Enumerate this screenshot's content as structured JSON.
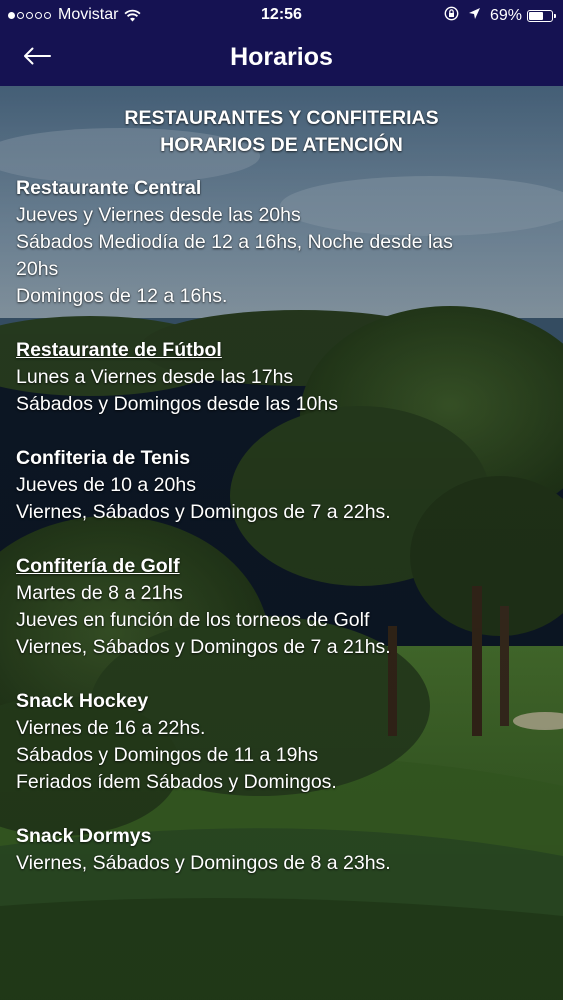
{
  "status_bar": {
    "carrier": "Movistar",
    "time": "12:56",
    "battery": "69%",
    "battery_level": 0.69,
    "icons": [
      "signal-dots-icon",
      "wifi-icon",
      "orientation-lock-icon",
      "location-arrow-icon",
      "battery-icon"
    ]
  },
  "nav": {
    "title": "Horarios",
    "back_icon": "arrow-left-icon",
    "bar_color": "#151252"
  },
  "content": {
    "heading_line1": "RESTAURANTES Y CONFITERIAS",
    "heading_line2": "HORARIOS DE ATENCIÓN",
    "background": "golf course with pine trees",
    "venues": [
      {
        "name": "Restaurante Central",
        "lines": [
          "Jueves y Viernes desde las 20hs",
          "Sábados Mediodía de 12 a 16hs, Noche desde las",
          "20hs",
          "Domingos de 12 a 16hs."
        ]
      },
      {
        "name": "Restaurante de Fútbol",
        "lines": [
          "Lunes a Viernes desde las 17hs",
          "Sábados y Domingos desde las 10hs"
        ]
      },
      {
        "name": "Confiteria de Tenis",
        "lines": [
          "Jueves de 10 a 20hs",
          "Viernes, Sábados y Domingos de 7 a 22hs."
        ]
      },
      {
        "name": "Confitería de Golf",
        "lines": [
          "Martes de 8 a 21hs",
          "Jueves en función de los torneos de Golf",
          "Viernes, Sábados y Domingos de 7 a 21hs."
        ]
      },
      {
        "name": "Snack Hockey",
        "lines": [
          "Viernes de 16 a 22hs.",
          "Sábados y Domingos de 11 a 19hs",
          "Feriados ídem Sábados y Domingos."
        ]
      },
      {
        "name": "Snack Dormys",
        "lines": [
          "Viernes, Sábados y Domingos de 8 a 23hs."
        ]
      }
    ]
  }
}
